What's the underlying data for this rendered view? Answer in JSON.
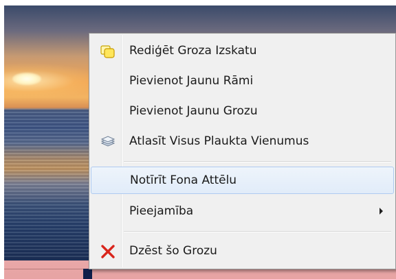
{
  "context_menu": {
    "items": [
      {
        "label": "Rediģēt Groza Izskatu",
        "icon": "edit-shape-icon"
      },
      {
        "label": "Pievienot Jaunu Rāmi",
        "icon": ""
      },
      {
        "label": "Pievienot Jaunu Grozu",
        "icon": ""
      },
      {
        "label": "Atlasīt Visus Plaukta Vienumus",
        "icon": "stack-icon"
      },
      {
        "label": "Notīrīt Fona Attēlu",
        "icon": "",
        "highlighted": true
      },
      {
        "label": "Pieejamība",
        "icon": "",
        "submenu": true
      },
      {
        "label": "Dzēst šo Grozu",
        "icon": "delete-x-icon"
      }
    ]
  },
  "colors": {
    "menu_bg": "#f0f0f0",
    "highlight_border": "#aecaf0",
    "delete_icon": "#d9251c",
    "taskbar": "#e7a3a3"
  }
}
